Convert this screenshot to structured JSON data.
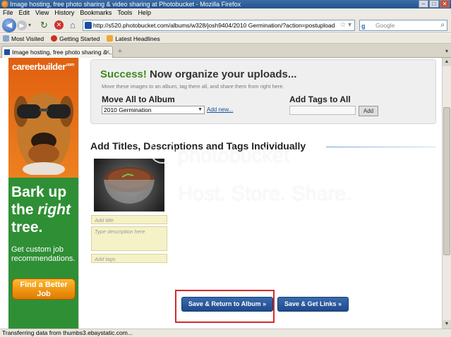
{
  "window": {
    "title": "Image hosting, free photo sharing & video sharing at Photobucket - Mozilla Firefox"
  },
  "menu": [
    "File",
    "Edit",
    "View",
    "History",
    "Bookmarks",
    "Tools",
    "Help"
  ],
  "url": "http://s520.photobucket.com/albums/w328/josh9404/2010 Germination/?action=postupload",
  "search_placeholder": "Google",
  "bookmarks": [
    "Most Visited",
    "Getting Started",
    "Latest Headlines"
  ],
  "tab": {
    "label": "Image hosting, free photo sharing & ..."
  },
  "ad": {
    "logo": "careerbuilder",
    "logo_suffix": ".com",
    "headline_1": "Bark up",
    "headline_2a": "the",
    "headline_2b": "right",
    "headline_3": "tree.",
    "subtext": "Get custom job recommendations.",
    "button": "Find a Better Job"
  },
  "success": {
    "word": "Success!",
    "title": "Now organize your uploads...",
    "description": "Move these images to an album, tag them all, and share them from right here.",
    "move_label": "Move All to Album",
    "album_selected": "2010 Germination",
    "add_new": "Add new...",
    "tags_label": "Add Tags to All",
    "add_button": "Add"
  },
  "individual": {
    "title": "Add Titles, Descriptions and Tags Individually",
    "title_placeholder": "Add title",
    "description_placeholder": "Type description here",
    "tags_placeholder": "Add tags"
  },
  "buttons": {
    "save_return": "Save & Return to Album »",
    "save_links": "Save & Get Links »"
  },
  "watermark": {
    "line1": "photobucket",
    "line2": "Host. Store. Share."
  },
  "status": "Transferring data from thumbs3.ebaystatic.com..."
}
